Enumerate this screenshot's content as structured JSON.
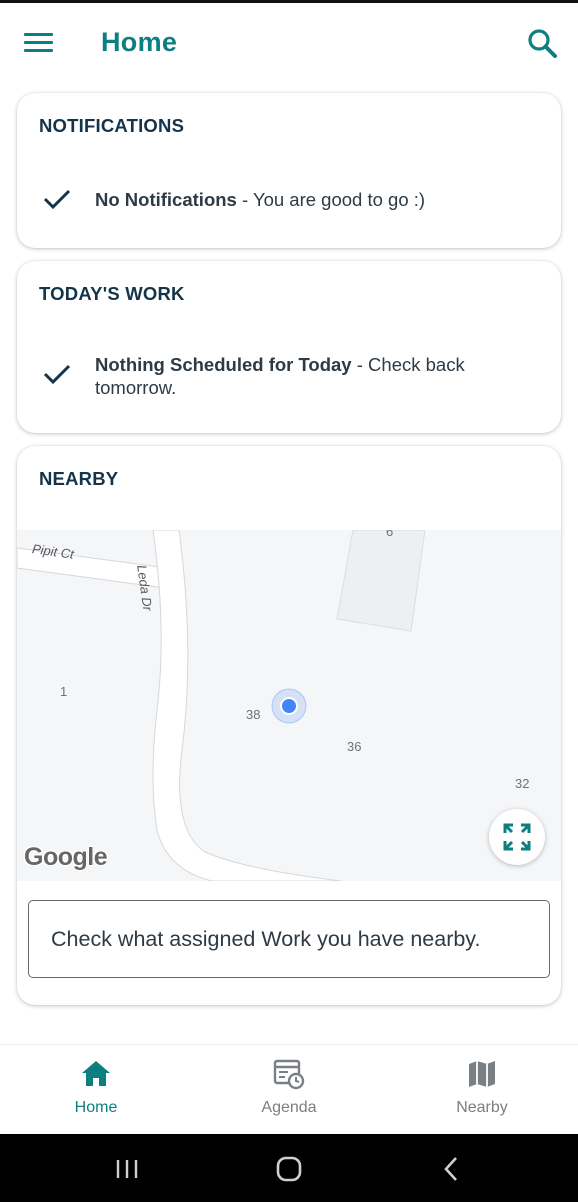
{
  "header": {
    "title": "Home",
    "menu_icon": "hamburger-menu-icon",
    "search_icon": "search-icon"
  },
  "colors": {
    "accent": "#0d7f80",
    "heading": "#14344a",
    "text": "#2e3a44",
    "map_bg": "#f5f6f8",
    "location_dot": "#4285f4"
  },
  "notifications": {
    "title": "NOTIFICATIONS",
    "icon": "checkmark-icon",
    "bold_text": "No Notifications",
    "detail_text": " - You are good to go :)"
  },
  "todays_work": {
    "title": "TODAY'S WORK",
    "icon": "checkmark-icon",
    "bold_text": "Nothing Scheduled for Today",
    "detail_text": " - Check back tomorrow."
  },
  "nearby": {
    "title": "NEARBY",
    "map": {
      "streets": [
        "Pipit Ct",
        "Leda Dr"
      ],
      "address_numbers": [
        "6",
        "1",
        "38",
        "36",
        "32"
      ],
      "attribution": "Google",
      "expand_icon": "expand-fullscreen-icon"
    },
    "prompt": "Check what assigned Work you have nearby."
  },
  "bottom_nav": {
    "items": [
      {
        "label": "Home",
        "icon": "home-icon",
        "active": true
      },
      {
        "label": "Agenda",
        "icon": "agenda-calendar-icon",
        "active": false
      },
      {
        "label": "Nearby",
        "icon": "map-icon",
        "active": false
      }
    ]
  },
  "system_nav": {
    "recents_icon": "recents-icon",
    "home_icon": "home-circle-icon",
    "back_icon": "back-icon"
  }
}
